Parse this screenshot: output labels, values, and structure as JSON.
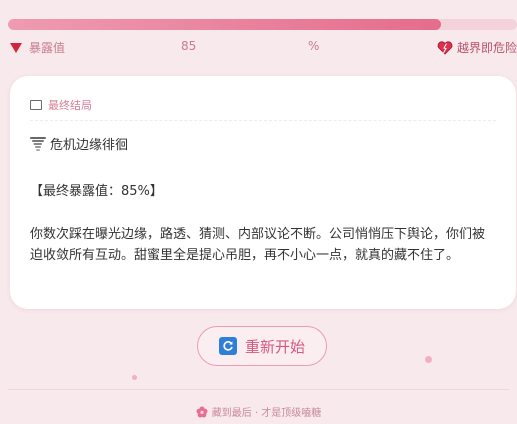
{
  "meter": {
    "value": 85,
    "fraction": 0.85,
    "safe_label": "暴露值",
    "value_label": "85",
    "unit_label": "%",
    "danger_label": "越界即危险",
    "colors": {
      "fill": "#e56d8c",
      "track": "#f4d2da"
    },
    "icons": {
      "safe": "red-triangle-icon",
      "danger": "heart-icon"
    }
  },
  "card": {
    "header_icon": "book-icon",
    "header_label": "最终结局",
    "ending_icon": "tornado-icon",
    "ending_title": "危机边缘徘徊",
    "final_score": "【最终暴露值：85%】",
    "description": "你数次踩在曝光边缘，路透、猜测、内部议论不断。公司悄悄压下舆论，你们被迫收敛所有互动。甜蜜里全是提心吊胆，再不小心一点，就真的藏不住了。"
  },
  "restart_button": {
    "icon": "refresh-icon",
    "label": "重新开始"
  },
  "footer": {
    "icon": "flower-icon",
    "text": "藏到最后 · 才是顶级嗑糖"
  }
}
